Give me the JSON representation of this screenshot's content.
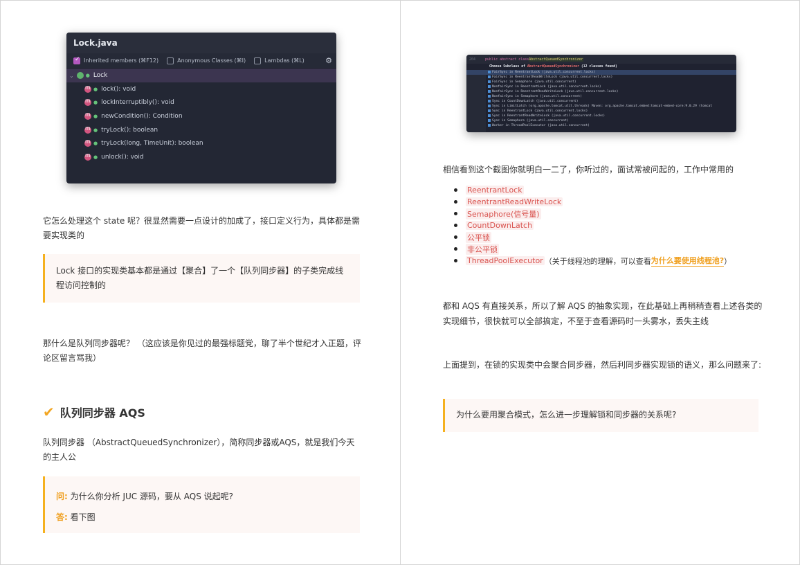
{
  "left": {
    "ide": {
      "title": "Lock.java",
      "options": [
        {
          "label": "Inherited members (⌘F12)",
          "checked": true
        },
        {
          "label": "Anonymous Classes (⌘I)",
          "checked": false
        },
        {
          "label": "Lambdas (⌘L)",
          "checked": false
        }
      ],
      "root": "Lock",
      "methods": [
        "lock(): void",
        "lockInterruptibly(): void",
        "newCondition(): Condition",
        "tryLock(): boolean",
        "tryLock(long, TimeUnit): boolean",
        "unlock(): void"
      ]
    },
    "para1": "它怎么处理这个 state 呢？很显然需要一点设计的加成了，接口定义行为，具体都是需要实现类的",
    "quote1": "Lock 接口的实现类基本都是通过【聚合】了一个【队列同步器】的子类完成线程访问控制的",
    "para2": "那什么是队列同步器呢？ （这应该是你见过的最强标题党，聊了半个世纪才入正题，评论区留言骂我）",
    "heading": "队列同步器 AQS",
    "para3": "队列同步器 （AbstractQueuedSynchronizer），简称同步器或AQS，就是我们今天的主人公",
    "qa": {
      "q_key": "问:",
      "q_text": "为什么你分析 JUC 源码，要从 AQS 说起呢?",
      "a_key": "答:",
      "a_text": "看下图"
    }
  },
  "right": {
    "ide2": {
      "code_line_no": "204",
      "code_prefix": "public abstract class ",
      "code_class": "AbstractQueuedSynchronizer",
      "header_prefix": "Choose Subclass of ",
      "header_class": "AbstractQueuedSynchronizer",
      "header_suffix": " (12 classes found)",
      "rows": [
        "FairSync in ReentrantLock (java.util.concurrent.locks)",
        "FairSync in ReentrantReadWriteLock (java.util.concurrent.locks)",
        "FairSync in Semaphore (java.util.concurrent)",
        "NonfairSync in ReentrantLock (java.util.concurrent.locks)",
        "NonfairSync in ReentrantReadWriteLock (java.util.concurrent.locks)",
        "NonfairSync in Semaphore (java.util.concurrent)",
        "Sync in CountDownLatch (java.util.concurrent)",
        "Sync in LimitLatch (org.apache.tomcat.util.threads)  Maven: org.apache.tomcat.embed:tomcat-embed-core:9.0.29 (tomcat",
        "Sync in ReentrantLock (java.util.concurrent.locks)",
        "Sync in ReentrantReadWriteLock (java.util.concurrent.locks)",
        "Sync in Semaphore (java.util.concurrent)",
        "Worker in ThreadPoolExecutor (java.util.concurrent)"
      ]
    },
    "para1": "相信看到这个截图你就明白一二了，你听过的，面试常被问起的，工作中常用的",
    "list": [
      {
        "code": "ReentrantLock",
        "rest": ""
      },
      {
        "code": "ReentrantReadWriteLock",
        "rest": ""
      },
      {
        "code": "Semaphore(信号量)",
        "rest": ""
      },
      {
        "code": "CountDownLatch",
        "rest": ""
      },
      {
        "code": "公平锁",
        "rest": ""
      },
      {
        "code": "非公平锁",
        "rest": ""
      },
      {
        "code": "ThreadPoolExecutor",
        "rest": "（关于线程池的理解，可以查看 ",
        "link": "为什么要使用线程池?",
        "tail": "）"
      }
    ],
    "para2": "都和 AQS 有直接关系，所以了解 AQS 的抽象实现，在此基础上再稍稍查看上述各类的实现细节，很快就可以全部搞定，不至于查看源码时一头雾水，丢失主线",
    "para3": "上面提到，在锁的实现类中会聚合同步器，然后利同步器实现锁的语义，那么问题来了:",
    "quote1": "为什么要用聚合模式，怎么进一步理解锁和同步器的关系呢?"
  }
}
